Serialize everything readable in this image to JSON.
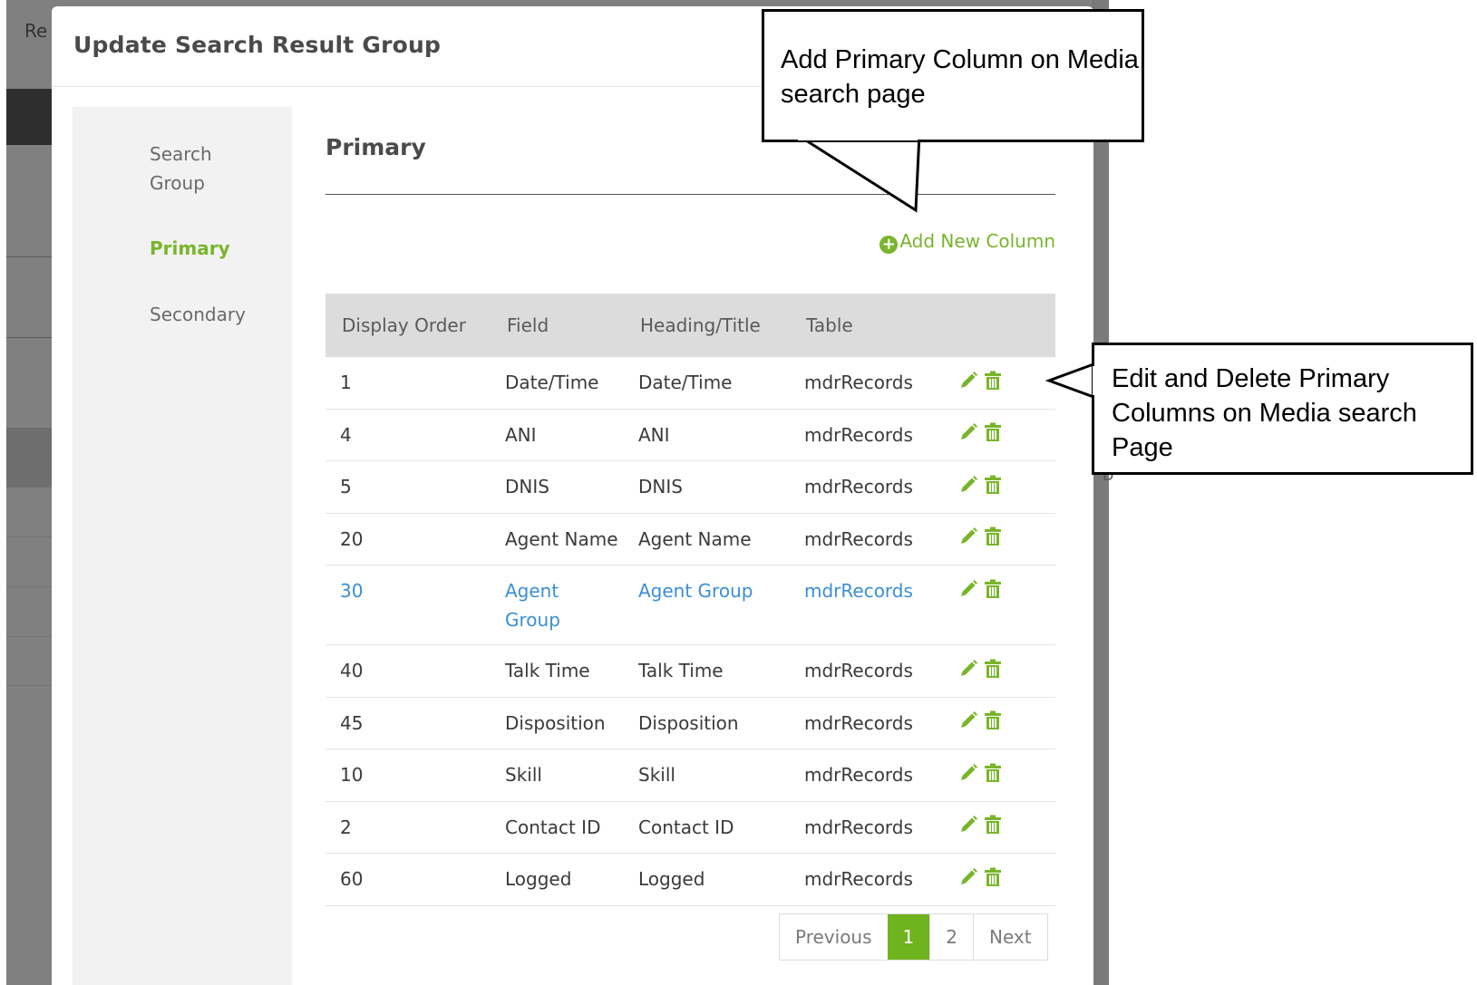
{
  "background": {
    "title_fragment": "Re",
    "edge_letter": "D"
  },
  "modal": {
    "title": "Update Search Result Group",
    "nav": [
      {
        "label": "Search\nGroup"
      },
      {
        "label": "Primary"
      },
      {
        "label": "Secondary"
      }
    ],
    "section_title": "Primary",
    "add_link": "Add New Column",
    "table": {
      "headers": [
        "Display Order",
        "Field",
        "Heading/Title",
        "Table"
      ],
      "rows": [
        {
          "order": "1",
          "field": "Date/Time",
          "heading": "Date/Time",
          "table": "mdrRecords"
        },
        {
          "order": "4",
          "field": "ANI",
          "heading": "ANI",
          "table": "mdrRecords"
        },
        {
          "order": "5",
          "field": "DNIS",
          "heading": "DNIS",
          "table": "mdrRecords"
        },
        {
          "order": "20",
          "field": "Agent Name",
          "heading": "Agent Name",
          "table": "mdrRecords"
        },
        {
          "order": "30",
          "field": "Agent Group",
          "heading": "Agent Group",
          "table": "mdrRecords"
        },
        {
          "order": "40",
          "field": "Talk Time",
          "heading": "Talk Time",
          "table": "mdrRecords"
        },
        {
          "order": "45",
          "field": "Disposition",
          "heading": "Disposition",
          "table": "mdrRecords"
        },
        {
          "order": "10",
          "field": "Skill",
          "heading": "Skill",
          "table": "mdrRecords"
        },
        {
          "order": "2",
          "field": "Contact ID",
          "heading": "Contact ID",
          "table": "mdrRecords"
        },
        {
          "order": "60",
          "field": "Logged",
          "heading": "Logged",
          "table": "mdrRecords"
        }
      ]
    },
    "pager": {
      "previous": "Previous",
      "current": "1",
      "page2": "2",
      "next": "Next"
    }
  },
  "callouts": {
    "add": "Add Primary Column on Media search page",
    "edit": "Edit and Delete Primary Columns on Media search Page"
  },
  "colors": {
    "accent_green": "#78b52a",
    "link_blue": "#3b8fd6",
    "overlay_gray": "#808080"
  }
}
